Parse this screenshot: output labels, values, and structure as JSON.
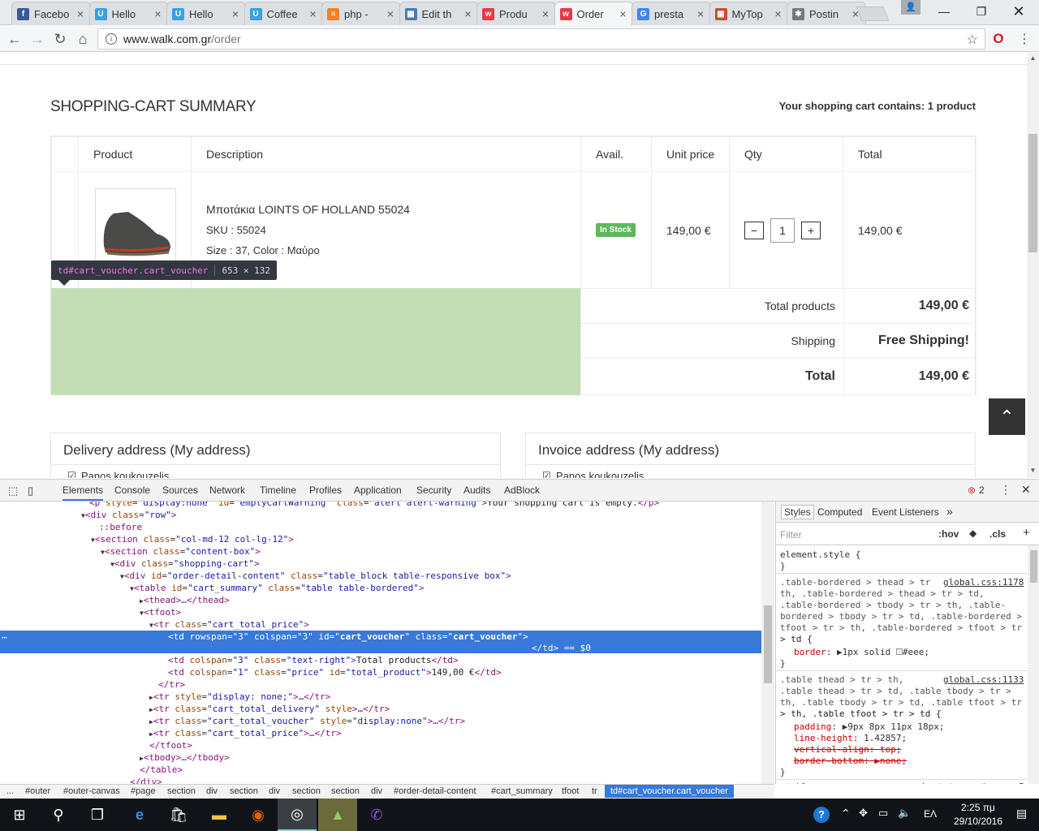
{
  "tabs": [
    {
      "label": "Facebo",
      "icon": "facebook-icon",
      "color": "#3b5998",
      "glyph": "f"
    },
    {
      "label": "Hello",
      "icon": "u-icon",
      "color": "#3aa0e0",
      "glyph": "U"
    },
    {
      "label": "Hello",
      "icon": "u-icon",
      "color": "#3aa0e0",
      "glyph": "U"
    },
    {
      "label": "Coffee",
      "icon": "u-icon",
      "color": "#3aa0e0",
      "glyph": "U"
    },
    {
      "label": "php -",
      "icon": "stackoverflow-icon",
      "color": "#f48024",
      "glyph": "≡"
    },
    {
      "label": "Edit th",
      "icon": "edit-icon",
      "color": "#4a7ab5",
      "glyph": "▦"
    },
    {
      "label": "Produ",
      "icon": "walk-icon",
      "color": "#e63946",
      "glyph": "w"
    },
    {
      "label": "Order",
      "icon": "walk-icon",
      "color": "#e63946",
      "glyph": "w"
    },
    {
      "label": "presta",
      "icon": "google-icon",
      "color": "#4285f4",
      "glyph": "G"
    },
    {
      "label": "MyTop",
      "icon": "apps-icon",
      "color": "#c94d2a",
      "glyph": "▦"
    },
    {
      "label": "Postin",
      "icon": "puzzle-icon",
      "color": "#777",
      "glyph": "✱"
    }
  ],
  "address": {
    "url_host": "www.walk.com.gr",
    "url_path": "/order"
  },
  "page": {
    "title": "SHOPPING-CART SUMMARY",
    "cart_count": "Your shopping cart contains: 1 product",
    "headers": [
      "Product",
      "Description",
      "Avail.",
      "Unit price",
      "Qty",
      "Total"
    ],
    "item": {
      "name": "Μποτάκια LOINTS OF HOLLAND 55024",
      "sku": "SKU : 55024",
      "attrs": "Size : 37, Color : Μαύρο",
      "avail": "In Stock",
      "unit_price": "149,00 €",
      "qty": "1",
      "total": "149,00 €",
      "minus": "−",
      "plus": "+"
    },
    "totals": [
      {
        "label": "Total products",
        "value": "149,00 €"
      },
      {
        "label": "Shipping",
        "value": "Free Shipping!"
      },
      {
        "label": "Total",
        "value": "149,00 €"
      }
    ],
    "tooltip": {
      "selector": "td#cart_voucher.cart_voucher",
      "size": "653 × 132"
    },
    "delivery": "Delivery address (My address)",
    "invoice": "Invoice address (My address)",
    "delivery_name": "Panos koukouzelis",
    "invoice_name": "Panos koukouzelis"
  },
  "devtools": {
    "tabs": [
      "Elements",
      "Console",
      "Sources",
      "Network",
      "Timeline",
      "Profiles",
      "Application",
      "Security",
      "Audits",
      "AdBlock"
    ],
    "error_count": "2",
    "styles_tabs": [
      "Styles",
      "Computed",
      "Event Listeners",
      "»"
    ],
    "filter": "Filter",
    "hov": ":hov",
    "cls": ".cls",
    "crumbs": [
      "...",
      "#outer",
      "#outer-canvas",
      "#page",
      "section",
      "div",
      "section",
      "div",
      "section",
      "section",
      "div",
      "#order-detail-content",
      "#cart_summary",
      "tfoot",
      "tr",
      "td#cart_voucher.cart_voucher"
    ]
  },
  "taskbar": {
    "time": "2:25 πμ",
    "date": "29/10/2016",
    "lang": "ΕΛ"
  }
}
